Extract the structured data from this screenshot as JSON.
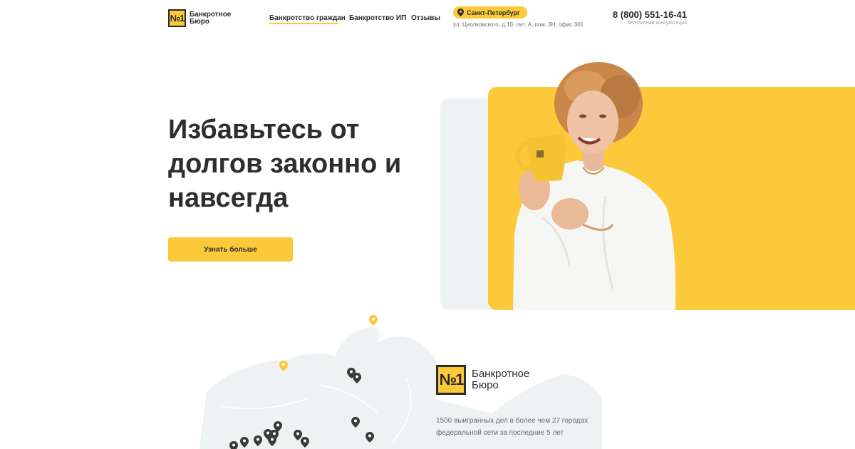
{
  "brand": {
    "badge": "№1",
    "name": "Банкротное Бюро"
  },
  "nav": {
    "items": [
      {
        "label": "Банкротство граждан",
        "active": true
      },
      {
        "label": "Банкротство ИП",
        "active": false
      },
      {
        "label": "Отзывы",
        "active": false
      }
    ]
  },
  "location": {
    "city": "Санкт-Петербург",
    "address": "ул. Циолковского, д.10, лит. А, пом. 3Н, офис 301"
  },
  "contact": {
    "phone": "8 (800) 551-16-41",
    "caption": "бесплатная консультация"
  },
  "hero": {
    "title": "Избавьтесь от долгов законно и навсегда",
    "cta_label": "Узнать больше"
  },
  "company": {
    "badge": "№1",
    "name": "Банкротное Бюро",
    "description": "1500 выигранных дел в более чем 27 городах федеральной сети за последние 5 лет"
  },
  "colors": {
    "accent": "#fbc93a",
    "text": "#2b2b2b",
    "muted": "#6b6b6b",
    "map": "#eef2f3"
  }
}
